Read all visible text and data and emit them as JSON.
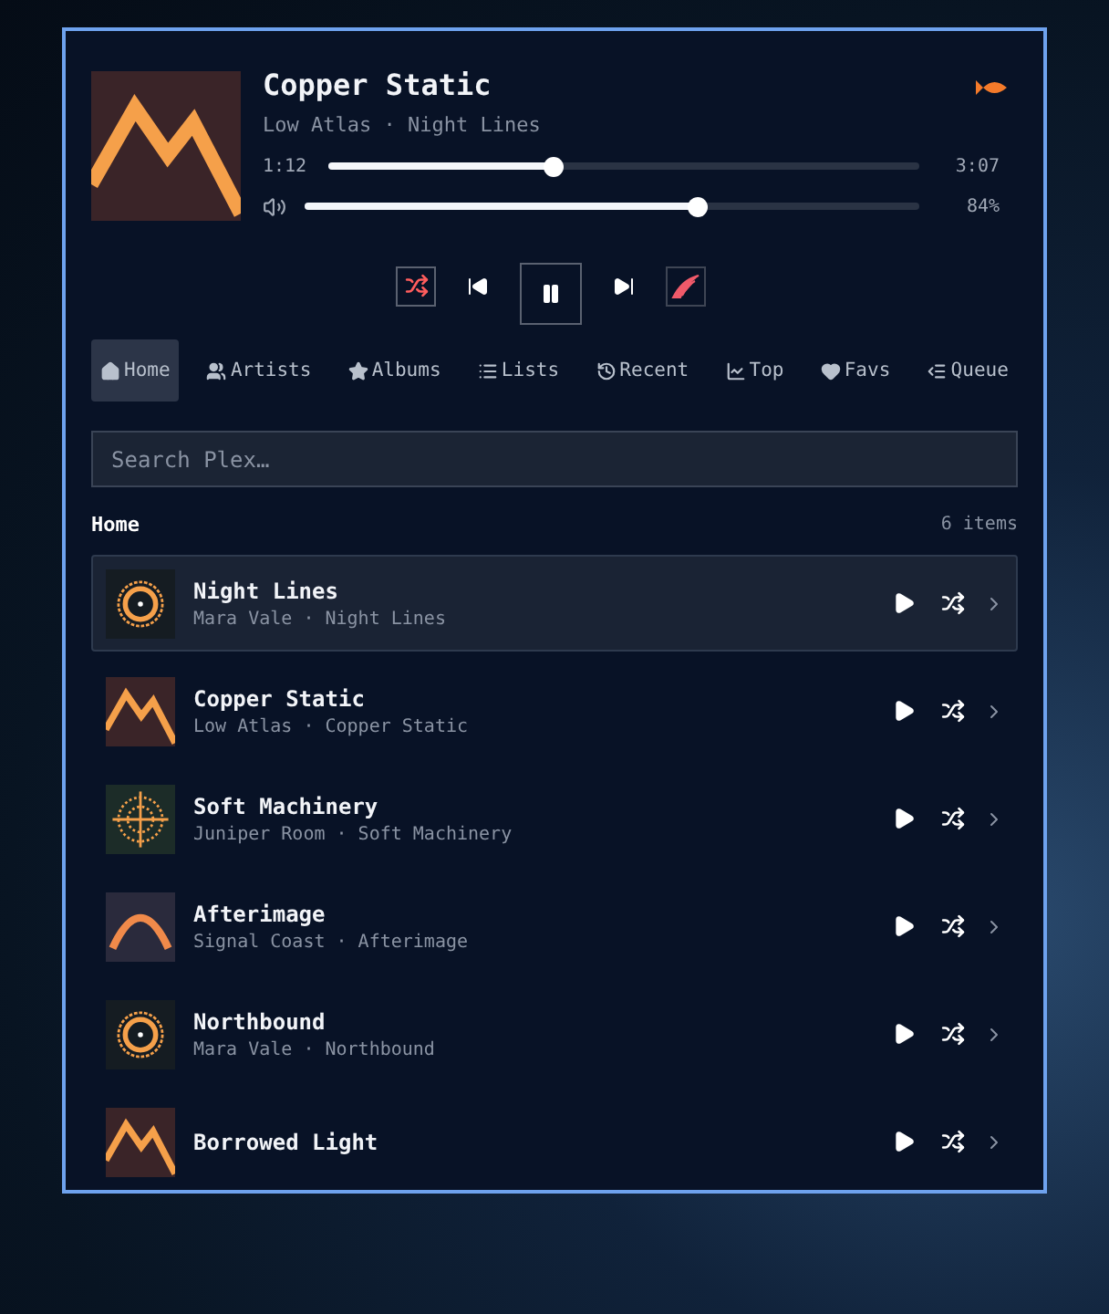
{
  "now_playing": {
    "title": "Copper Static",
    "subtitle": "Low Atlas · Night Lines",
    "kind": "mountain",
    "elapsed": "1:12",
    "duration": "3:07",
    "progress": {
      "level": 0.38
    },
    "volume": {
      "level": 0.64
    },
    "volume_reading": "84%",
    "shuffle": true
  },
  "tabs": [
    {
      "label": "Home",
      "kind": "home",
      "selected": true
    },
    {
      "label": "Artists",
      "kind": "users",
      "selected": false
    },
    {
      "label": "Albums",
      "kind": "star",
      "selected": false
    },
    {
      "label": "Lists",
      "kind": "list",
      "selected": false
    },
    {
      "label": "Recent",
      "kind": "history",
      "selected": false
    },
    {
      "label": "Top",
      "kind": "chart",
      "selected": false
    },
    {
      "label": "Favs",
      "kind": "heart",
      "selected": false
    },
    {
      "label": "Queue",
      "kind": "queue",
      "selected": false
    }
  ],
  "search": {
    "placeholder": "Search Plex…"
  },
  "section": {
    "title": "Home",
    "count": "6 items"
  },
  "rows": [
    {
      "title": "Night Lines",
      "subtitle": "Mara Vale · Night Lines",
      "kind": "ring",
      "selected": true
    },
    {
      "title": "Copper Static",
      "subtitle": "Low Atlas · Copper Static",
      "kind": "mountain",
      "selected": false
    },
    {
      "title": "Soft Machinery",
      "subtitle": "Juniper Room · Soft Machinery",
      "kind": "crosshair",
      "selected": false
    },
    {
      "title": "Afterimage",
      "subtitle": "Signal Coast · Afterimage",
      "kind": "arch",
      "selected": false
    },
    {
      "title": "Northbound",
      "subtitle": "Mara Vale · Northbound",
      "kind": "ring",
      "selected": false
    },
    {
      "title": "Borrowed Light",
      "kind": "mountain",
      "selected": false
    }
  ]
}
